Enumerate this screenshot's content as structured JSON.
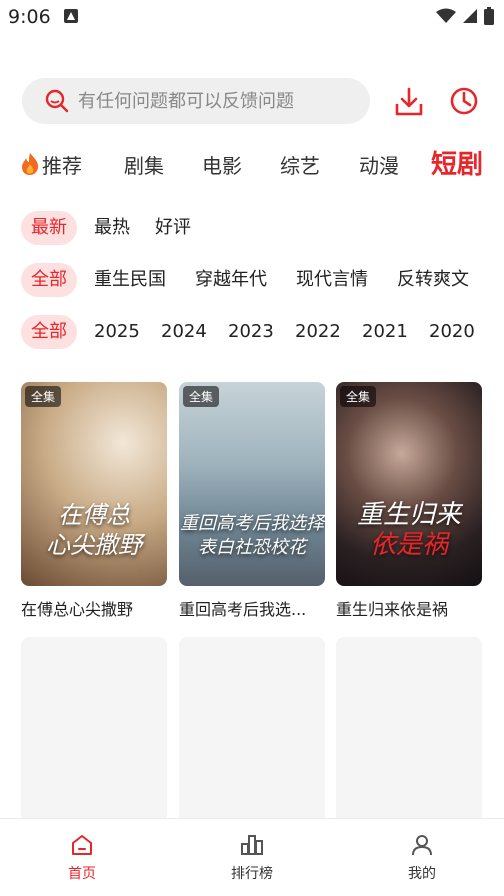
{
  "status_bar": {
    "time": "9:06"
  },
  "search": {
    "placeholder": "有任何问题都可以反馈问题"
  },
  "top_tabs": [
    "推荐",
    "剧集",
    "电影",
    "综艺",
    "动漫",
    "短剧"
  ],
  "filters": {
    "sort": [
      "最新",
      "最热",
      "好评"
    ],
    "genre": [
      "全部",
      "重生民国",
      "穿越年代",
      "现代言情",
      "反转爽文"
    ],
    "year": [
      "全部",
      "2025",
      "2024",
      "2023",
      "2022",
      "2021",
      "2020"
    ]
  },
  "videos": [
    {
      "badge": "全集",
      "poster_line1": "在傅总",
      "poster_line2": "心尖撒野",
      "title": "在傅总心尖撒野"
    },
    {
      "badge": "全集",
      "poster_line1": "重回高考后我选择",
      "poster_line2": "表白社恐校花",
      "title": "重回高考后我选..."
    },
    {
      "badge": "全集",
      "poster_line1": "重生归来",
      "poster_line2": "依是祸",
      "title": "重生归来依是祸"
    }
  ],
  "bottom_nav": [
    "首页",
    "排行榜",
    "我的"
  ],
  "colors": {
    "accent": "#e8262a",
    "chip_bg": "#fde0e0",
    "search_bg": "#efefef"
  }
}
